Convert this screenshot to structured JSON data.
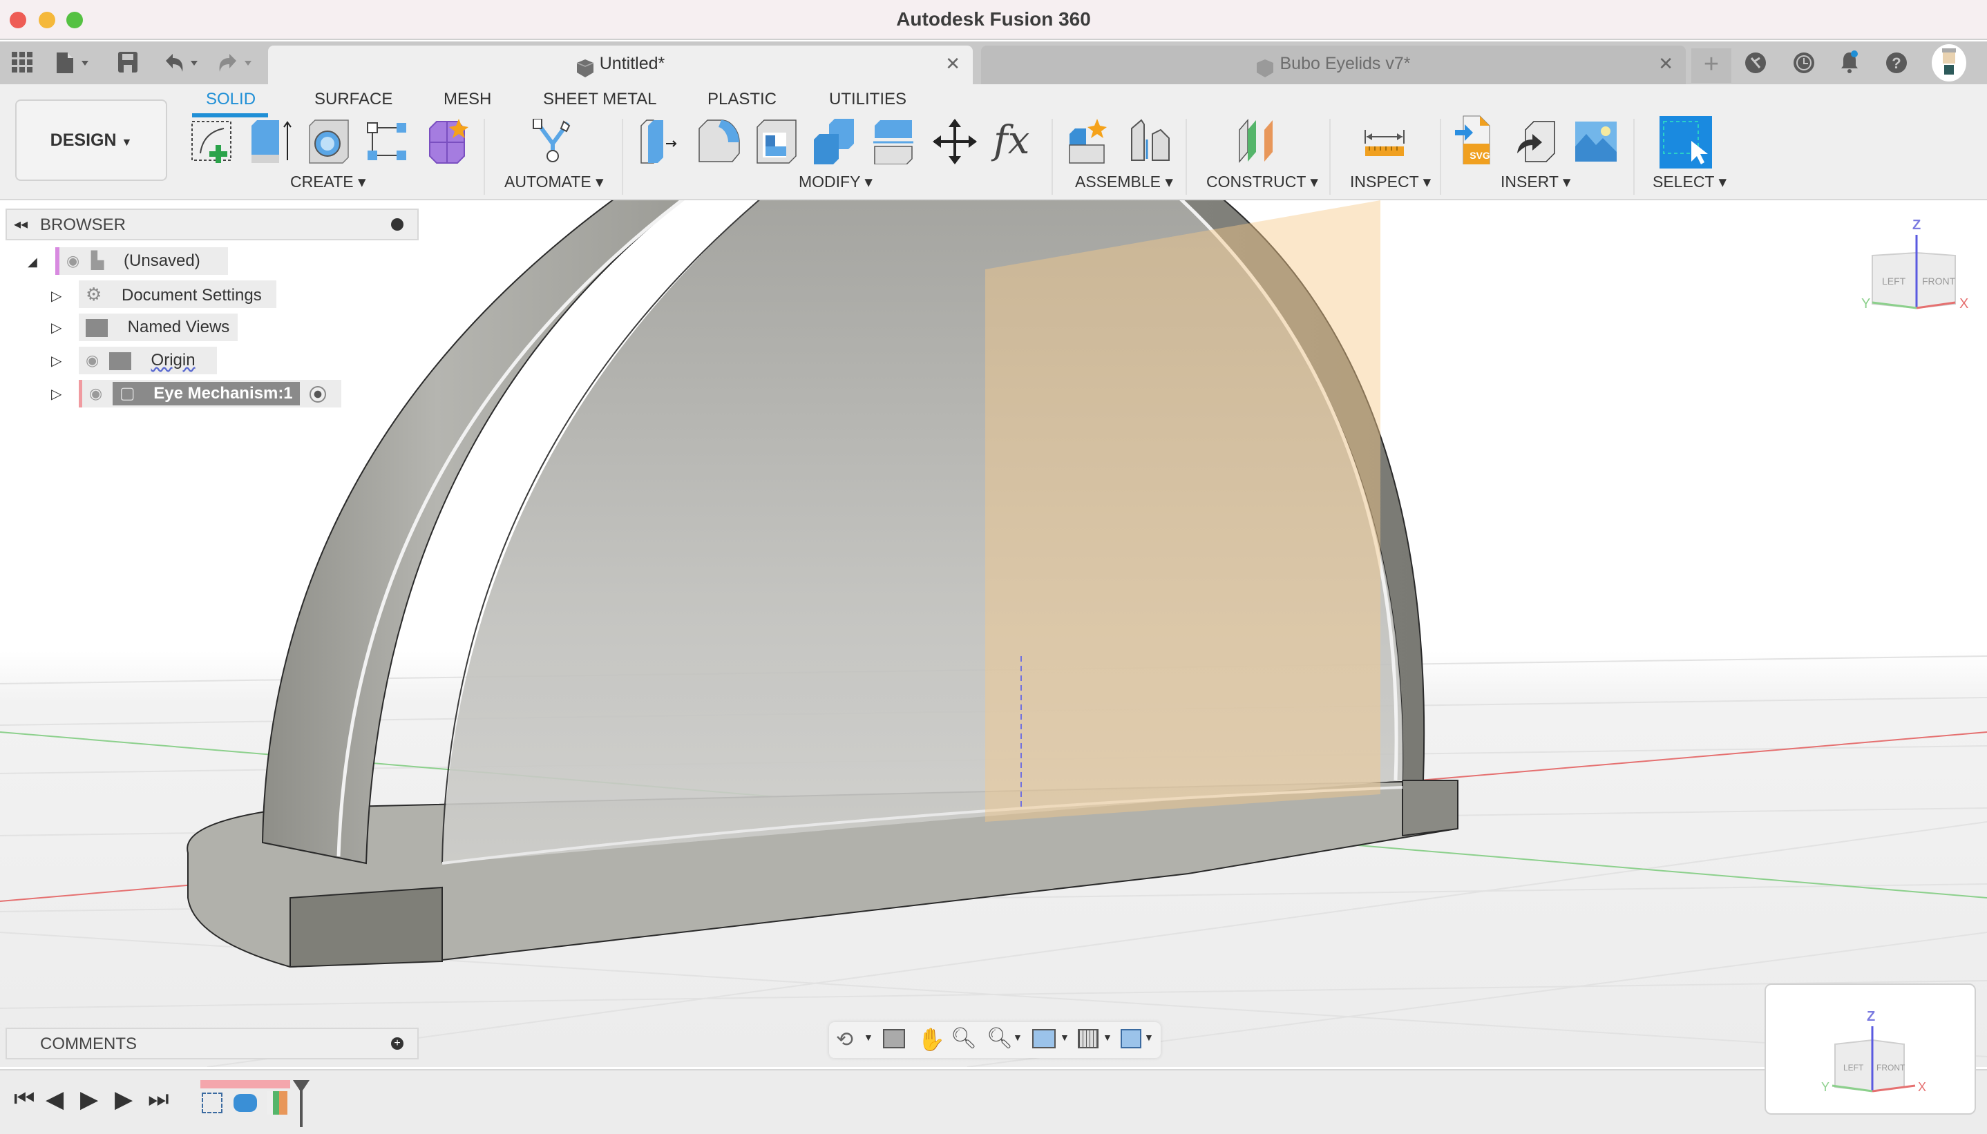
{
  "window": {
    "title": "Autodesk Fusion 360",
    "traffic_lights": [
      "close",
      "minimize",
      "zoom"
    ]
  },
  "quick_access": {
    "icons": [
      "apps-grid-icon",
      "file-icon",
      "save-icon",
      "undo-icon",
      "redo-icon"
    ]
  },
  "tabs": [
    {
      "label": "Untitled*",
      "active": true
    },
    {
      "label": "Bubo Eyelids v7*",
      "active": false
    }
  ],
  "top_right_icons": [
    "new-tab-plus-icon",
    "extensions-icon",
    "job-status-icon",
    "notifications-icon",
    "help-icon",
    "user-avatar"
  ],
  "ribbon": {
    "workspace": "DESIGN",
    "tabs": [
      "SOLID",
      "SURFACE",
      "MESH",
      "SHEET METAL",
      "PLASTIC",
      "UTILITIES"
    ],
    "active_tab": "SOLID",
    "groups": [
      {
        "label": "CREATE",
        "tools": [
          "create-sketch",
          "extrude",
          "revolve",
          "pattern",
          "form"
        ]
      },
      {
        "label": "AUTOMATE",
        "tools": [
          "automate"
        ]
      },
      {
        "label": "MODIFY",
        "tools": [
          "press-pull",
          "fillet",
          "shell",
          "combine",
          "split-body",
          "move-copy",
          "parameters"
        ]
      },
      {
        "label": "ASSEMBLE",
        "tools": [
          "new-component",
          "joint"
        ]
      },
      {
        "label": "CONSTRUCT",
        "tools": [
          "offset-plane"
        ]
      },
      {
        "label": "INSPECT",
        "tools": [
          "measure"
        ]
      },
      {
        "label": "INSERT",
        "tools": [
          "insert-svg",
          "insert-derive",
          "insert-canvas"
        ]
      },
      {
        "label": "SELECT",
        "tools": [
          "select"
        ]
      }
    ]
  },
  "browser": {
    "title": "BROWSER",
    "root": "(Unsaved)",
    "items": [
      {
        "label": "Document Settings",
        "icon": "gear-icon",
        "visible_toggle": false
      },
      {
        "label": "Named Views",
        "icon": "folder-icon",
        "visible_toggle": false
      },
      {
        "label": "Origin",
        "icon": "folder-icon",
        "visible_toggle": true
      },
      {
        "label": "Eye Mechanism:1",
        "icon": "component-icon",
        "visible_toggle": true,
        "active": true
      }
    ]
  },
  "viewcube": {
    "faces": [
      "LEFT",
      "FRONT"
    ],
    "axes": [
      "X",
      "Y",
      "Z"
    ]
  },
  "comments": {
    "title": "COMMENTS"
  },
  "nav_toolbar": {
    "icons": [
      "orbit-icon",
      "look-at-icon",
      "pan-icon",
      "zoom-icon",
      "fit-icon",
      "display-settings-icon",
      "grid-snap-icon",
      "viewports-icon"
    ]
  },
  "timeline": {
    "controls": [
      "go-to-start",
      "step-back",
      "play",
      "step-forward",
      "go-to-end"
    ],
    "features": [
      "sketch",
      "revolve",
      "offset-plane"
    ]
  },
  "colors": {
    "accent": "#1f8fd6",
    "model": "#8a8a82",
    "plane": "#f7c98a",
    "x_axis": "#e05050",
    "y_axis": "#50b050",
    "z_axis": "#5050e0"
  }
}
